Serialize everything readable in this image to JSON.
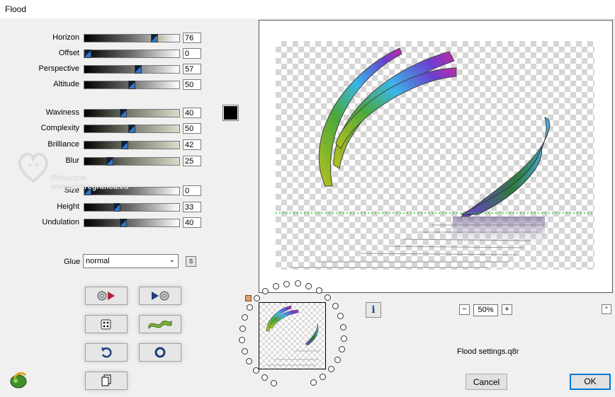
{
  "window": {
    "title": "Flood"
  },
  "sliders": [
    {
      "id": "horizon",
      "label": "Horizon",
      "value": "76",
      "fill": 76,
      "gradient": "g1",
      "max": 100
    },
    {
      "id": "offset",
      "label": "Offset",
      "value": "0",
      "fill": 0,
      "gradient": "g1",
      "max": 100
    },
    {
      "id": "perspective",
      "label": "Perspective",
      "value": "57",
      "fill": 57,
      "gradient": "g1",
      "max": 100
    },
    {
      "id": "altitude",
      "label": "Altitude",
      "value": "50",
      "fill": 50,
      "gradient": "g1",
      "max": 100
    },
    {
      "id": "waviness",
      "label": "Waviness",
      "value": "40",
      "fill": 40,
      "gradient": "g2",
      "max": 100
    },
    {
      "id": "complexity",
      "label": "Complexity",
      "value": "50",
      "fill": 50,
      "gradient": "g2",
      "max": 100
    },
    {
      "id": "brilliance",
      "label": "Brilliance",
      "value": "42",
      "fill": 42,
      "gradient": "g2",
      "max": 100
    },
    {
      "id": "blur",
      "label": "Blur",
      "value": "25",
      "fill": 25,
      "gradient": "g2",
      "max": 100
    },
    {
      "id": "size",
      "label": "Size",
      "value": "0",
      "fill": 0,
      "gradient": "g1",
      "max": 100
    },
    {
      "id": "height",
      "label": "Height",
      "value": "33",
      "fill": 33,
      "gradient": "g1",
      "max": 100
    },
    {
      "id": "undulation",
      "label": "Undulation",
      "value": "40",
      "fill": 40,
      "gradient": "g1",
      "max": 100
    }
  ],
  "color_swatch": "#000000",
  "glue": {
    "label": "Glue",
    "value": "normal",
    "s_button": "S"
  },
  "watermark": {
    "name": "Pinuccia",
    "site": "www.sidiregrafica.eu"
  },
  "zoom": {
    "value": "50%",
    "minus": "−",
    "plus": "+"
  },
  "info_button": "i",
  "scroll_up": "^",
  "settings_file": "Flood settings.q8r",
  "buttons": {
    "cancel": "Cancel",
    "ok": "OK"
  },
  "icons": {
    "left_arrow_btn": "preset-previous-icon",
    "right_arrow_btn": "preset-next-icon",
    "dice_btn": "random-dice-icon",
    "wave_btn": "wave-icon",
    "undo_btn": "undo-icon",
    "reset_btn": "reset-ring-icon",
    "copy_btn": "copy-icon"
  }
}
